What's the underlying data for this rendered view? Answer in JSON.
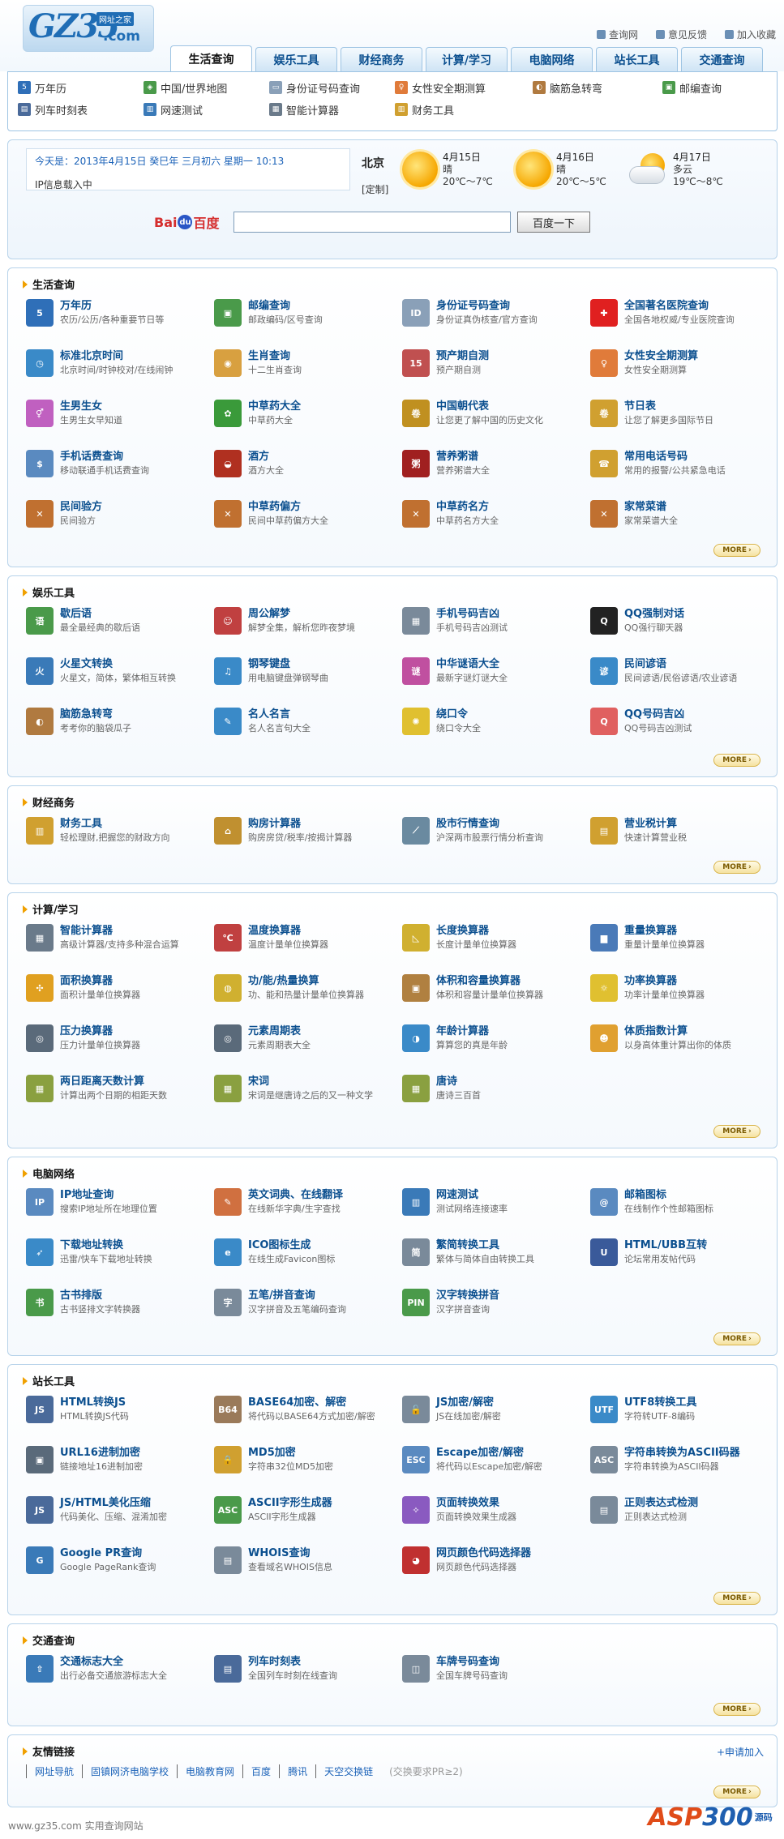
{
  "logo": {
    "main": "GZ35",
    "sub": "网址之家",
    "domain": ".com"
  },
  "toplinks": [
    {
      "label": "查询网",
      "color": "#6a8fb5"
    },
    {
      "label": "意见反馈",
      "color": "#6a8fb5"
    },
    {
      "label": "加入收藏",
      "color": "#6a8fb5"
    }
  ],
  "tabs": [
    "生活查询",
    "娱乐工具",
    "财经商务",
    "计算/学习",
    "电脑网络",
    "站长工具",
    "交通查询"
  ],
  "subnav": [
    {
      "label": "万年历",
      "icon": "calendar-icon",
      "color": "#2f6fb8",
      "glyph": "5"
    },
    {
      "label": "中国/世界地图",
      "icon": "map-icon",
      "color": "#4a9a4a",
      "glyph": "◈"
    },
    {
      "label": "身份证号码查询",
      "icon": "id-card-icon",
      "color": "#8aa0b8",
      "glyph": "▭"
    },
    {
      "label": "女性安全期测算",
      "icon": "woman-icon",
      "color": "#e07b3a",
      "glyph": "♀"
    },
    {
      "label": "脑筋急转弯",
      "icon": "brain-icon",
      "color": "#b07a40",
      "glyph": "◐"
    },
    {
      "label": "邮编查询",
      "icon": "postcode-icon",
      "color": "#4a9a4a",
      "glyph": "▣"
    },
    {
      "label": "列车时刻表",
      "icon": "train-icon",
      "color": "#4a6a9a",
      "glyph": "▤"
    },
    {
      "label": "网速测试",
      "icon": "speed-test-icon",
      "color": "#3a7ab8",
      "glyph": "▥"
    },
    {
      "label": "智能计算器",
      "icon": "calculator-icon",
      "color": "#6a7a8a",
      "glyph": "▦"
    },
    {
      "label": "财务工具",
      "icon": "finance-icon",
      "color": "#d0a030",
      "glyph": "▥"
    }
  ],
  "info": {
    "date_line": "今天是：2013年4月15日 癸巳年 三月初六 星期一 10:13",
    "ip_line": "IP信息载入中",
    "city": "北京",
    "custom": "[定制]",
    "weather": [
      {
        "date": "4月15日",
        "cond": "晴",
        "temp": "20℃～7℃",
        "icon": "sun-icon"
      },
      {
        "date": "4月16日",
        "cond": "晴",
        "temp": "20℃～5℃",
        "icon": "sun-icon"
      },
      {
        "date": "4月17日",
        "cond": "多云",
        "temp": "19℃～8℃",
        "icon": "cloud-icon"
      }
    ],
    "baidu": {
      "b1": "Bai",
      "paw": "du",
      "b2": "百度"
    },
    "search_button": "百度一下"
  },
  "more_label": "MORE",
  "sections": [
    {
      "title": "生活查询",
      "items": [
        {
          "t": "万年历",
          "d": "农历/公历/各种重要节日等",
          "c": "#2f6fb8",
          "g": "5",
          "icon": "calendar-icon"
        },
        {
          "t": "邮编查询",
          "d": "邮政编码/区号查询",
          "c": "#4a9a4a",
          "g": "▣",
          "icon": "postcode-icon"
        },
        {
          "t": "身份证号码查询",
          "d": "身份证真伪核查/官方查询",
          "c": "#8aa0b8",
          "g": "ID",
          "icon": "id-card-icon"
        },
        {
          "t": "全国著名医院查询",
          "d": "全国各地权威/专业医院查询",
          "c": "#e02020",
          "g": "✚",
          "icon": "hospital-icon"
        },
        {
          "t": "标准北京时间",
          "d": "北京时间/时钟校对/在线闹钟",
          "c": "#3a8ac8",
          "g": "◷",
          "icon": "clock-icon"
        },
        {
          "t": "生肖查询",
          "d": "十二生肖查询",
          "c": "#d8a040",
          "g": "◉",
          "icon": "zodiac-icon"
        },
        {
          "t": "预产期自测",
          "d": "预产期自测",
          "c": "#c05050",
          "g": "15",
          "icon": "due-date-icon"
        },
        {
          "t": "女性安全期测算",
          "d": "女性安全期测算",
          "c": "#e07b3a",
          "g": "♀",
          "icon": "woman-icon"
        },
        {
          "t": "生男生女",
          "d": "生男生女早知道",
          "c": "#c060c0",
          "g": "⚥",
          "icon": "gender-icon"
        },
        {
          "t": "中草药大全",
          "d": "中草药大全",
          "c": "#3a9a3a",
          "g": "✿",
          "icon": "herb-icon"
        },
        {
          "t": "中国朝代表",
          "d": "让您更了解中国的历史文化",
          "c": "#c09020",
          "g": "卷",
          "icon": "scroll-icon"
        },
        {
          "t": "节日表",
          "d": "让您了解更多国际节日",
          "c": "#d0a030",
          "g": "卷",
          "icon": "festival-icon"
        },
        {
          "t": "手机话费查询",
          "d": "移动联通手机话费查询",
          "c": "#5a8ac0",
          "g": "$",
          "icon": "phone-bill-icon"
        },
        {
          "t": "酒方",
          "d": "酒方大全",
          "c": "#b03020",
          "g": "◒",
          "icon": "wine-icon"
        },
        {
          "t": "营养粥谱",
          "d": "营养粥谱大全",
          "c": "#a02020",
          "g": "粥",
          "icon": "porridge-icon"
        },
        {
          "t": "常用电话号码",
          "d": "常用的报警/公共紧急电话",
          "c": "#d0a030",
          "g": "☎",
          "icon": "phone-icon"
        },
        {
          "t": "民间验方",
          "d": "民间验方",
          "c": "#c07030",
          "g": "✕",
          "icon": "remedy-icon"
        },
        {
          "t": "中草药偏方",
          "d": "民间中草药偏方大全",
          "c": "#c07030",
          "g": "✕",
          "icon": "remedy-icon"
        },
        {
          "t": "中草药名方",
          "d": "中草药名方大全",
          "c": "#c07030",
          "g": "✕",
          "icon": "remedy-icon"
        },
        {
          "t": "家常菜谱",
          "d": "家常菜谱大全",
          "c": "#c07030",
          "g": "✕",
          "icon": "recipe-icon"
        }
      ]
    },
    {
      "title": "娱乐工具",
      "items": [
        {
          "t": "歇后语",
          "d": "最全最经典的歇后语",
          "c": "#4a9a4a",
          "g": "语",
          "icon": "saying-icon"
        },
        {
          "t": "周公解梦",
          "d": "解梦全集，解析您昨夜梦境",
          "c": "#c04040",
          "g": "☺",
          "icon": "dream-icon"
        },
        {
          "t": "手机号码吉凶",
          "d": "手机号码吉凶测试",
          "c": "#7a8a9a",
          "g": "▦",
          "icon": "mobile-number-icon"
        },
        {
          "t": "QQ强制对话",
          "d": "QQ强行聊天器",
          "c": "#222222",
          "g": "Q",
          "icon": "qq-icon"
        },
        {
          "t": "火星文转换",
          "d": "火星文，简体，繁体相互转换",
          "c": "#3a7ab8",
          "g": "火",
          "icon": "mars-text-icon"
        },
        {
          "t": "钢琴键盘",
          "d": "用电脑键盘弹钢琴曲",
          "c": "#3a8ac8",
          "g": "♫",
          "icon": "piano-icon"
        },
        {
          "t": "中华谜语大全",
          "d": "最新字谜灯谜大全",
          "c": "#c050a0",
          "g": "谜",
          "icon": "riddle-icon"
        },
        {
          "t": "民间谚语",
          "d": "民间谚语/民俗谚语/农业谚语",
          "c": "#3a8ac8",
          "g": "谚",
          "icon": "proverb-icon"
        },
        {
          "t": "脑筋急转弯",
          "d": "考考你的脑袋瓜子",
          "c": "#b07a40",
          "g": "◐",
          "icon": "brain-icon"
        },
        {
          "t": "名人名言",
          "d": "名人名言句大全",
          "c": "#3a8ac8",
          "g": "✎",
          "icon": "quote-icon"
        },
        {
          "t": "绕口令",
          "d": "绕口令大全",
          "c": "#e0c030",
          "g": "✺",
          "icon": "tongue-twister-icon"
        },
        {
          "t": "QQ号码吉凶",
          "d": "QQ号码吉凶测试",
          "c": "#e06060",
          "g": "Q",
          "icon": "qq-number-icon"
        }
      ]
    },
    {
      "title": "财经商务",
      "items": [
        {
          "t": "财务工具",
          "d": "轻松理财,把握您的财政方向",
          "c": "#d0a030",
          "g": "▥",
          "icon": "finance-icon"
        },
        {
          "t": "购房计算器",
          "d": "购房房贷/税率/按揭计算器",
          "c": "#c09030",
          "g": "⌂",
          "icon": "house-calculator-icon"
        },
        {
          "t": "股市行情查询",
          "d": "沪深两市股票行情分析查询",
          "c": "#6a8aa0",
          "g": "⟋",
          "icon": "stock-chart-icon"
        },
        {
          "t": "营业税计算",
          "d": "快速计算营业税",
          "c": "#d0a030",
          "g": "▤",
          "icon": "tax-icon"
        }
      ]
    },
    {
      "title": "计算/学习",
      "items": [
        {
          "t": "智能计算器",
          "d": "高级计算器/支持多种混合运算",
          "c": "#6a7a8a",
          "g": "▦",
          "icon": "calculator-icon"
        },
        {
          "t": "温度换算器",
          "d": "温度计量单位换算器",
          "c": "#c04040",
          "g": "℃",
          "icon": "thermometer-icon"
        },
        {
          "t": "长度换算器",
          "d": "长度计量单位换算器",
          "c": "#d0b030",
          "g": "◺",
          "icon": "ruler-icon"
        },
        {
          "t": "重量换算器",
          "d": "重量计量单位换算器",
          "c": "#4a7ab8",
          "g": "▆",
          "icon": "weight-icon"
        },
        {
          "t": "面积换算器",
          "d": "面积计量单位换算器",
          "c": "#e0a020",
          "g": "✣",
          "icon": "area-icon"
        },
        {
          "t": "功/能/热量换算",
          "d": "功、能和热量计量单位换算器",
          "c": "#d0b030",
          "g": "◍",
          "icon": "energy-icon"
        },
        {
          "t": "体积和容量换算器",
          "d": "体积和容量计量单位换算器",
          "c": "#b08040",
          "g": "▣",
          "icon": "volume-icon"
        },
        {
          "t": "功率换算器",
          "d": "功率计量单位换算器",
          "c": "#e0c030",
          "g": "☼",
          "icon": "power-icon"
        },
        {
          "t": "压力换算器",
          "d": "压力计量单位换算器",
          "c": "#5a6a7a",
          "g": "◎",
          "icon": "pressure-icon"
        },
        {
          "t": "元素周期表",
          "d": "元素周期表大全",
          "c": "#5a6a7a",
          "g": "◎",
          "icon": "periodic-table-icon"
        },
        {
          "t": "年龄计算器",
          "d": "算算您的真是年龄",
          "c": "#3a8ac8",
          "g": "◑",
          "icon": "age-icon"
        },
        {
          "t": "体质指数计算",
          "d": "以身高体重计算出你的体质",
          "c": "#e0a030",
          "g": "☻",
          "icon": "bmi-icon"
        },
        {
          "t": "两日距离天数计算",
          "d": "计算出两个日期的相距天数",
          "c": "#8aa040",
          "g": "▦",
          "icon": "days-between-icon"
        },
        {
          "t": "宋词",
          "d": "宋词是继唐诗之后的又一种文学",
          "c": "#8aa040",
          "g": "▦",
          "icon": "song-poetry-icon"
        },
        {
          "t": "唐诗",
          "d": "唐诗三百首",
          "c": "#8aa040",
          "g": "▦",
          "icon": "tang-poetry-icon"
        }
      ]
    },
    {
      "title": "电脑网络",
      "items": [
        {
          "t": "IP地址查询",
          "d": "搜索IP地址所在地理位置",
          "c": "#5a8ac0",
          "g": "IP",
          "icon": "ip-icon"
        },
        {
          "t": "英文词典、在线翻译",
          "d": "在线新华字典/生字查找",
          "c": "#d07040",
          "g": "✎",
          "icon": "dictionary-icon"
        },
        {
          "t": "网速测试",
          "d": "测试网络连接速率",
          "c": "#3a7ab8",
          "g": "▥",
          "icon": "speed-test-icon"
        },
        {
          "t": "邮箱图标",
          "d": "在线制作个性邮箱图标",
          "c": "#5a8ac0",
          "g": "@",
          "icon": "email-icon"
        },
        {
          "t": "下载地址转换",
          "d": "迅雷/快车下载地址转换",
          "c": "#3a8ac8",
          "g": "➶",
          "icon": "download-icon"
        },
        {
          "t": "ICO图标生成",
          "d": "在线生成Favicon图标",
          "c": "#3a8ac8",
          "g": "e",
          "icon": "ico-icon"
        },
        {
          "t": "繁简转换工具",
          "d": "繁体与简体自由转换工具",
          "c": "#7a8a9a",
          "g": "简",
          "icon": "convert-icon"
        },
        {
          "t": "HTML/UBB互转",
          "d": "论坛常用发帖代码",
          "c": "#3a5a9a",
          "g": "U",
          "icon": "ubb-icon"
        },
        {
          "t": "古书排版",
          "d": "古书竖排文字转换器",
          "c": "#4a9a4a",
          "g": "书",
          "icon": "book-icon"
        },
        {
          "t": "五笔/拼音查询",
          "d": "汉字拼音及五笔编码查询",
          "c": "#7a8a9a",
          "g": "字",
          "icon": "wubi-icon"
        },
        {
          "t": "汉字转换拼音",
          "d": "汉字拼音查询",
          "c": "#4a9a4a",
          "g": "PIN",
          "icon": "pinyin-icon"
        }
      ]
    },
    {
      "title": "站长工具",
      "items": [
        {
          "t": "HTML转换JS",
          "d": "HTML转换JS代码",
          "c": "#4a6a9a",
          "g": "JS",
          "icon": "html-js-icon"
        },
        {
          "t": "BASE64加密、解密",
          "d": "将代码以BASE64方式加密/解密",
          "c": "#9a7a5a",
          "g": "B64",
          "icon": "base64-icon"
        },
        {
          "t": "JS加密/解密",
          "d": "JS在线加密/解密",
          "c": "#7a8a9a",
          "g": "🔓",
          "icon": "js-crypt-icon"
        },
        {
          "t": "UTF8转换工具",
          "d": "字符转UTF-8编码",
          "c": "#3a8ac8",
          "g": "UTF",
          "icon": "utf8-icon"
        },
        {
          "t": "URL16进制加密",
          "d": "链接地址16进制加密",
          "c": "#5a6a7a",
          "g": "▣",
          "icon": "url-hex-icon"
        },
        {
          "t": "MD5加密",
          "d": "字符串32位MD5加密",
          "c": "#d0a030",
          "g": "🔒",
          "icon": "md5-icon"
        },
        {
          "t": "Escape加密/解密",
          "d": "将代码以Escape加密/解密",
          "c": "#5a8ac0",
          "g": "ESC",
          "icon": "escape-icon"
        },
        {
          "t": "字符串转换为ASCII码器",
          "d": "字符串转换为ASCII码器",
          "c": "#7a8a9a",
          "g": "ASC",
          "icon": "ascii-convert-icon"
        },
        {
          "t": "JS/HTML美化压缩",
          "d": "代码美化、压缩、混淆加密",
          "c": "#4a6a9a",
          "g": "JS",
          "icon": "beautify-icon"
        },
        {
          "t": "ASCII字形生成器",
          "d": "ASCII字形生成器",
          "c": "#4a9a4a",
          "g": "ASC",
          "icon": "ascii-art-icon"
        },
        {
          "t": "页面转换效果",
          "d": "页面转换效果生成器",
          "c": "#8a5ac0",
          "g": "✧",
          "icon": "page-effect-icon"
        },
        {
          "t": "正则表达式检测",
          "d": "正则表达式检测",
          "c": "#7a8a9a",
          "g": "▤",
          "icon": "regex-icon"
        },
        {
          "t": "Google PR查询",
          "d": "Google PageRank查询",
          "c": "#3a7ab8",
          "g": "G",
          "icon": "google-pr-icon"
        },
        {
          "t": "WHOIS查询",
          "d": "查看域名WHOIS信息",
          "c": "#7a8a9a",
          "g": "▤",
          "icon": "whois-icon"
        },
        {
          "t": "网页颜色代码选择器",
          "d": "网页颜色代码选择器",
          "c": "#c03030",
          "g": "◕",
          "icon": "color-picker-icon"
        }
      ]
    },
    {
      "title": "交通查询",
      "items": [
        {
          "t": "交通标志大全",
          "d": "出行必备交通旅游标志大全",
          "c": "#3a7ab8",
          "g": "⇧",
          "icon": "traffic-sign-icon"
        },
        {
          "t": "列车时刻表",
          "d": "全国列车时刻在线查询",
          "c": "#4a6a9a",
          "g": "▤",
          "icon": "train-icon"
        },
        {
          "t": "车牌号码查询",
          "d": "全国车牌号码查询",
          "c": "#7a8a9a",
          "g": "◫",
          "icon": "car-icon"
        }
      ]
    }
  ],
  "friends": {
    "title": "友情链接",
    "apply": "+申请加入",
    "links": [
      "网址导航",
      "固镇网济电脑学校",
      "电脑教育网",
      "百度",
      "腾讯",
      "天空交换链"
    ],
    "note": "(交换要求PR≥2)"
  },
  "footer": "www.gz35.com 实用查询网站",
  "watermark": {
    "a1": "ASP",
    "a2": "300",
    "a3": "源码"
  }
}
